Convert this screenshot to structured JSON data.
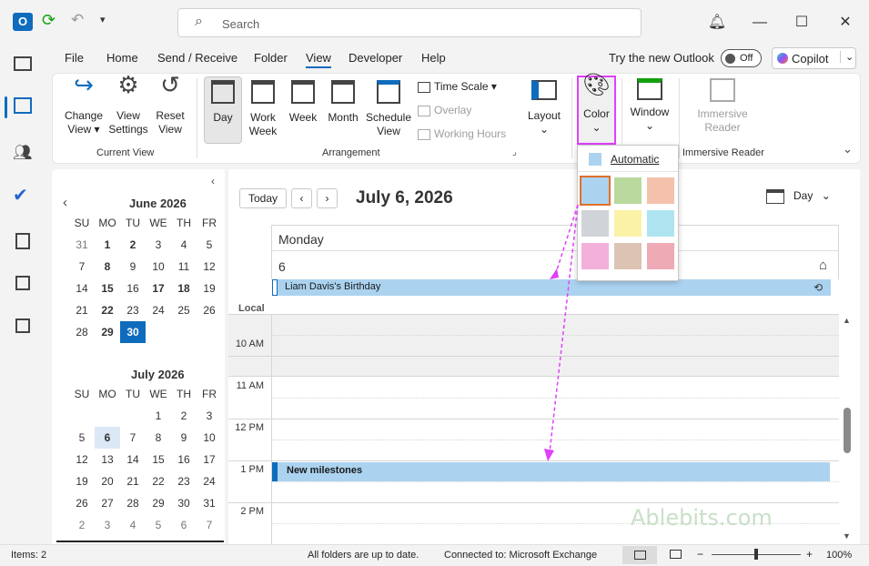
{
  "titlebar": {
    "search_placeholder": "Search"
  },
  "menu": {
    "tabs": [
      "File",
      "Home",
      "Send / Receive",
      "Folder",
      "View",
      "Developer",
      "Help"
    ],
    "try_new_outlook": "Try the new Outlook",
    "toggle_state": "Off",
    "copilot": "Copilot"
  },
  "ribbon": {
    "current_view": {
      "label": "Current View",
      "change_view": [
        "Change",
        "View"
      ],
      "view_settings": [
        "View",
        "Settings"
      ],
      "reset_view": [
        "Reset",
        "View"
      ]
    },
    "arrangement": {
      "label": "Arrangement",
      "day": "Day",
      "work_week": [
        "Work",
        "Week"
      ],
      "week": "Week",
      "month": "Month",
      "schedule_view": [
        "Schedule",
        "View"
      ],
      "time_scale": "Time Scale",
      "overlay": "Overlay",
      "working_hours": "Working Hours"
    },
    "layout": "Layout",
    "color": "Color",
    "window": "Window",
    "immersive_reader": {
      "label": "Immersive Reader",
      "button": [
        "Immersive",
        "Reader"
      ]
    }
  },
  "color_menu": {
    "automatic": "Automatic",
    "swatches": [
      "#abd3f0",
      "#b9d99e",
      "#f4c1ad",
      "#d0d4d8",
      "#fbf2a8",
      "#aee4ef",
      "#f2b0da",
      "#dcc3b4",
      "#eeaab5"
    ],
    "selected_index": 0
  },
  "mini_calendar": {
    "june": {
      "title": "June 2026",
      "headers": [
        "SU",
        "MO",
        "TU",
        "WE",
        "TH",
        "FR"
      ],
      "rows": [
        [
          "31",
          "1",
          "2",
          "3",
          "4",
          "5"
        ],
        [
          "7",
          "8",
          "9",
          "10",
          "11",
          "12"
        ],
        [
          "14",
          "15",
          "16",
          "17",
          "18",
          "19"
        ],
        [
          "21",
          "22",
          "23",
          "24",
          "25",
          "26"
        ],
        [
          "28",
          "29",
          "30",
          "",
          "",
          ""
        ]
      ]
    },
    "july": {
      "title": "July 2026",
      "headers": [
        "SU",
        "MO",
        "TU",
        "WE",
        "TH",
        "FR"
      ],
      "rows": [
        [
          "",
          "",
          "",
          "1",
          "2",
          "3"
        ],
        [
          "5",
          "6",
          "7",
          "8",
          "9",
          "10"
        ],
        [
          "12",
          "13",
          "14",
          "15",
          "16",
          "17"
        ],
        [
          "19",
          "20",
          "21",
          "22",
          "23",
          "24"
        ],
        [
          "26",
          "27",
          "28",
          "29",
          "30",
          "31"
        ],
        [
          "2",
          "3",
          "4",
          "5",
          "6",
          "7"
        ]
      ]
    }
  },
  "day_view": {
    "today_button": "Today",
    "date_heading": "July 6, 2026",
    "view_selector": "Day",
    "weekday": "Monday",
    "day_number": "6",
    "local_label": "Local",
    "all_day_event": "Liam Davis's Birthday",
    "hours": [
      "10 AM",
      "11 AM",
      "12 PM",
      "1 PM",
      "2 PM"
    ],
    "event": "New milestones",
    "watermark": "Ablebits.com"
  },
  "statusbar": {
    "items": "Items: 2",
    "sync": "All folders are up to date.",
    "connection": "Connected to: Microsoft Exchange",
    "zoom": "100%"
  },
  "colors": {
    "accent": "#0f6cbd",
    "highlight": "#e040fb",
    "event_blue": "#abd3f0"
  }
}
